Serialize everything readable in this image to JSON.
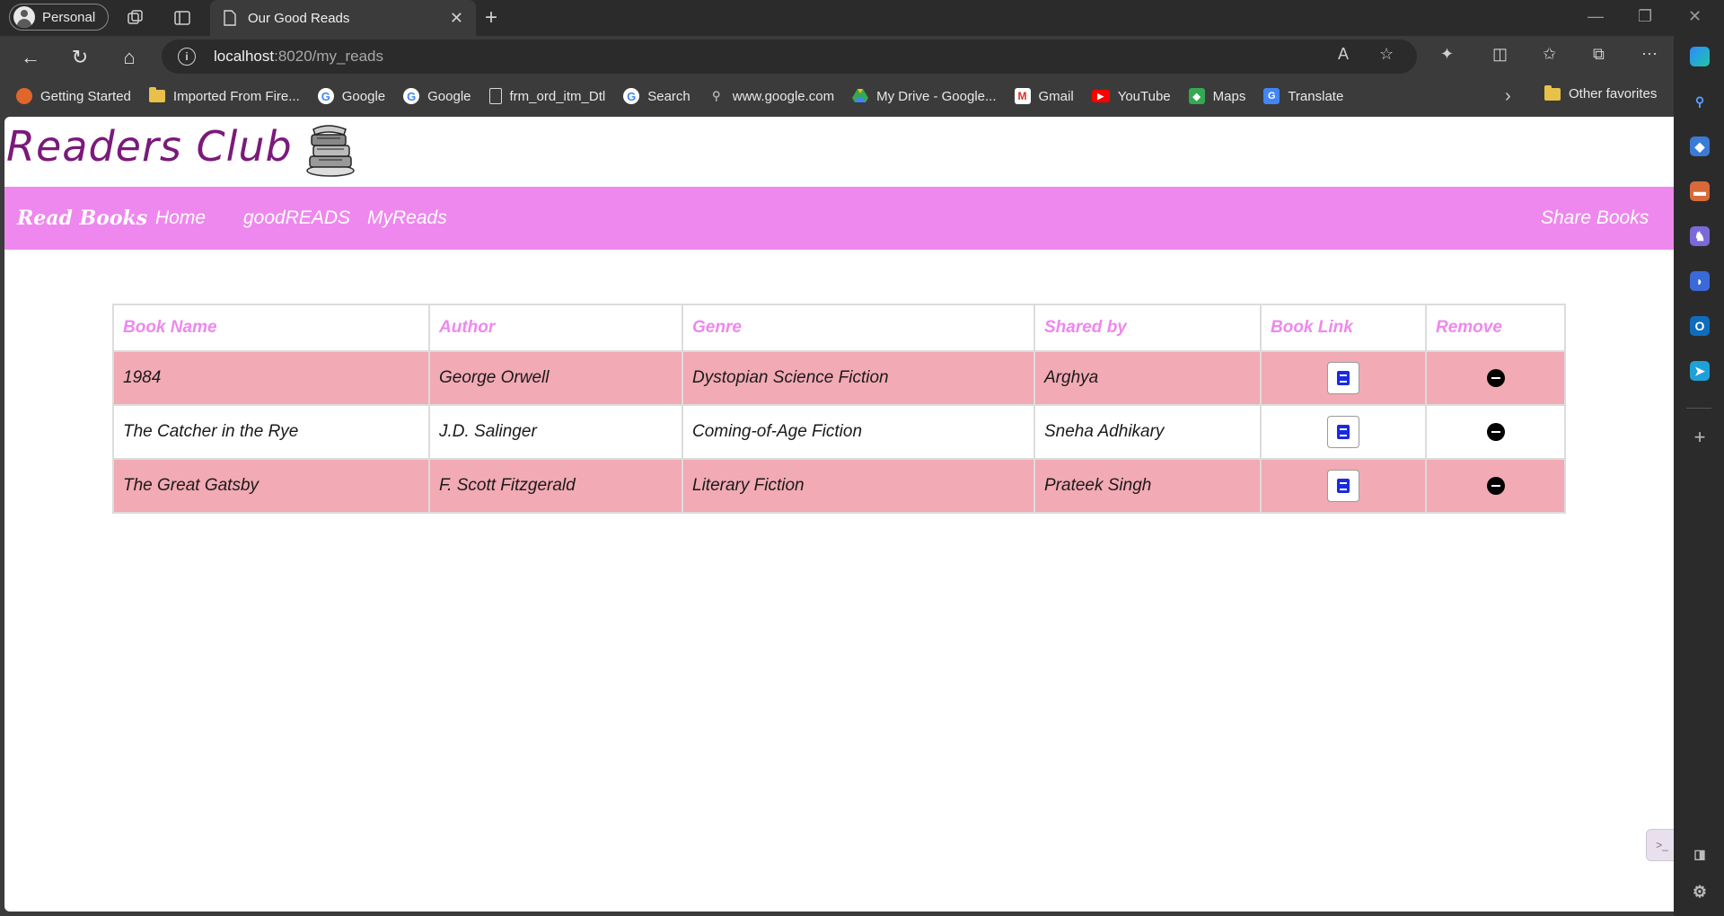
{
  "browser": {
    "profile_label": "Personal",
    "tab_title": "Our Good Reads",
    "url_host": "localhost",
    "url_path": ":8020/my_reads",
    "bookmarks": [
      {
        "label": "Getting Started",
        "icon": "firefox-icon"
      },
      {
        "label": "Imported From Fire...",
        "icon": "folder-icon"
      },
      {
        "label": "Google",
        "icon": "google-icon"
      },
      {
        "label": "Google",
        "icon": "google-icon"
      },
      {
        "label": "frm_ord_itm_Dtl",
        "icon": "page-icon"
      },
      {
        "label": "Search",
        "icon": "google-icon"
      },
      {
        "label": "www.google.com",
        "icon": "search-icon"
      },
      {
        "label": "My Drive - Google...",
        "icon": "drive-icon"
      },
      {
        "label": "Gmail",
        "icon": "gmail-icon"
      },
      {
        "label": "YouTube",
        "icon": "youtube-icon"
      },
      {
        "label": "Maps",
        "icon": "maps-icon"
      },
      {
        "label": "Translate",
        "icon": "translate-icon"
      }
    ],
    "other_favorites": "Other favorites"
  },
  "site": {
    "title": "Readers Club",
    "nav": {
      "brand": "Read Books",
      "home": "Home",
      "goodreads": "goodREADS",
      "myreads": "MyReads",
      "share": "Share Books"
    }
  },
  "table": {
    "headers": [
      "Book Name",
      "Author",
      "Genre",
      "Shared by",
      "Book Link",
      "Remove"
    ],
    "rows": [
      {
        "book": "1984",
        "author": "George Orwell",
        "genre": "Dystopian Science Fiction",
        "shared_by": "Arghya"
      },
      {
        "book": "The Catcher in the Rye",
        "author": "J.D. Salinger",
        "genre": "Coming-of-Age Fiction",
        "shared_by": "Sneha Adhikary"
      },
      {
        "book": "The Great Gatsby",
        "author": "F. Scott Fitzgerald",
        "genre": "Literary Fiction",
        "shared_by": "Prateek Singh"
      }
    ]
  },
  "colors": {
    "nav_bg": "#ee88ee",
    "title_color": "#7a1a7a",
    "row_pink": "#f2aab4",
    "header_text": "#ee88ee"
  }
}
